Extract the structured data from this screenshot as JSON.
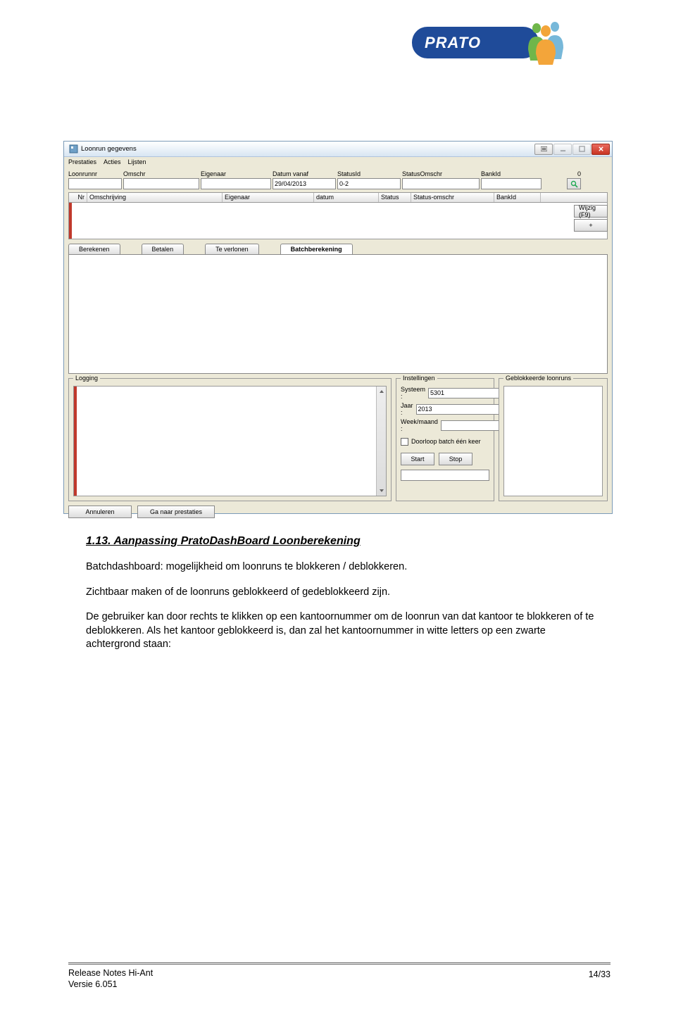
{
  "logo": {
    "text": "PRATO"
  },
  "window": {
    "title": "Loonrun gegevens",
    "menu": [
      "Prestaties",
      "Acties",
      "Lijsten"
    ],
    "filters": {
      "loonrunnr": {
        "label": "Loonrunnr",
        "value": ""
      },
      "omschr": {
        "label": "Omschr",
        "value": ""
      },
      "eigenaar": {
        "label": "Eigenaar",
        "value": ""
      },
      "datum": {
        "label": "Datum vanaf",
        "value": "29/04/2013"
      },
      "statusid": {
        "label": "StatusId",
        "value": "0-2"
      },
      "statusomschr": {
        "label": "StatusOmschr",
        "value": ""
      },
      "bankid": {
        "label": "BankId",
        "value": ""
      },
      "extra": {
        "label": "",
        "value": "0"
      }
    },
    "grid_columns": [
      "Nr",
      "Omschrijving",
      "Eigenaar",
      "datum",
      "Status",
      "Status-omschr",
      "BankId"
    ],
    "side_buttons": {
      "wijzig": "Wijzig (F9)",
      "plus": "+"
    },
    "tabs": [
      "Berekenen",
      "Betalen",
      "Te verlonen",
      "Batchberekening"
    ],
    "active_tab": "Batchberekening",
    "logging": {
      "legend": "Logging"
    },
    "instellingen": {
      "legend": "Instellingen",
      "systeem": {
        "label": "Systeem :",
        "value": "5301"
      },
      "jaar": {
        "label": "Jaar :",
        "value": "2013"
      },
      "week": {
        "label": "Week/maand :",
        "value": ""
      },
      "checkbox_label": "Doorloop batch één keer",
      "start": "Start",
      "stop": "Stop"
    },
    "blocked": {
      "legend": "Geblokkeerde loonruns"
    },
    "bottom": {
      "annuleren": "Annuleren",
      "prestaties": "Ga naar prestaties"
    }
  },
  "doc": {
    "heading": "1.13. Aanpassing PratoDashBoard Loonberekening",
    "p1": "Batchdashboard: mogelijkheid om loonruns te blokkeren / deblokkeren.",
    "p2": "Zichtbaar maken of de loonruns geblokkeerd of gedeblokkeerd zijn.",
    "p3": "De gebruiker kan door rechts te klikken op een kantoornummer om de loonrun van dat kantoor te blokkeren of te deblokkeren. Als het kantoor geblokkeerd is, dan zal het kantoornummer in witte letters op een zwarte achtergrond staan:"
  },
  "footer": {
    "line1": "Release Notes Hi-Ant",
    "line2": "Versie 6.051",
    "page": "14/33"
  }
}
